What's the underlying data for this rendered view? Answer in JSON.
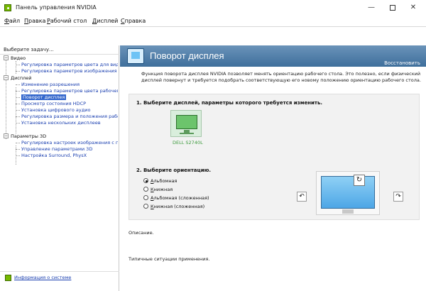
{
  "window": {
    "title": "Панель управления NVIDIA",
    "minimize": "—",
    "close": "✕"
  },
  "menu": [
    "Файл",
    "Правка",
    "Рабочий стол",
    "Дисплей",
    "Справка"
  ],
  "sidebar": {
    "title": "Выберите задачу...",
    "categories": [
      {
        "label": "Видео",
        "items": [
          "Регулировка параметров цвета для вид",
          "Регулировка параметров изображения д"
        ]
      },
      {
        "label": "Дисплей",
        "items": [
          "Изменение разрешения",
          "Регулировка параметров цвета рабочег",
          "Поворот дисплея",
          "Просмотр состояния HDCP",
          "Установка цифрового аудио",
          "Регулировка размера и положения рабо",
          "Установка нескольких дисплеев"
        ]
      },
      {
        "label": "Параметры 3D",
        "items": [
          "Регулировка настроек изображения с пр",
          "Управление параметрами 3D",
          "Настройка Surround, PhysX"
        ]
      }
    ],
    "selected": "Поворот дисплея",
    "system_info": "Информация о системе"
  },
  "page": {
    "title": "Поворот дисплея",
    "restore": "Восстановить",
    "description": "Функция поворота дисплея NVIDIA позволяет менять ориентацию рабочего стола. Это полезно, если физический дисплей повернут и требуется подобрать соответствующую его новому положению ориентацию рабочего стола.",
    "step1": "1. Выберите дисплей, параметры которого требуется изменить.",
    "display_name": "DELL S2740L",
    "step2": "2. Выберите ориентацию.",
    "orientations": [
      "Альбомная",
      "Книжная",
      "Альбомная (сложенная)",
      "Книжная (сложенная)"
    ],
    "selected_orientation": "Альбомная",
    "rotate_left": "↶",
    "rotate_right": "↷",
    "preview_rotate": "↻",
    "description_label": "Описание.",
    "usage_label": "Типичные ситуации применения."
  }
}
